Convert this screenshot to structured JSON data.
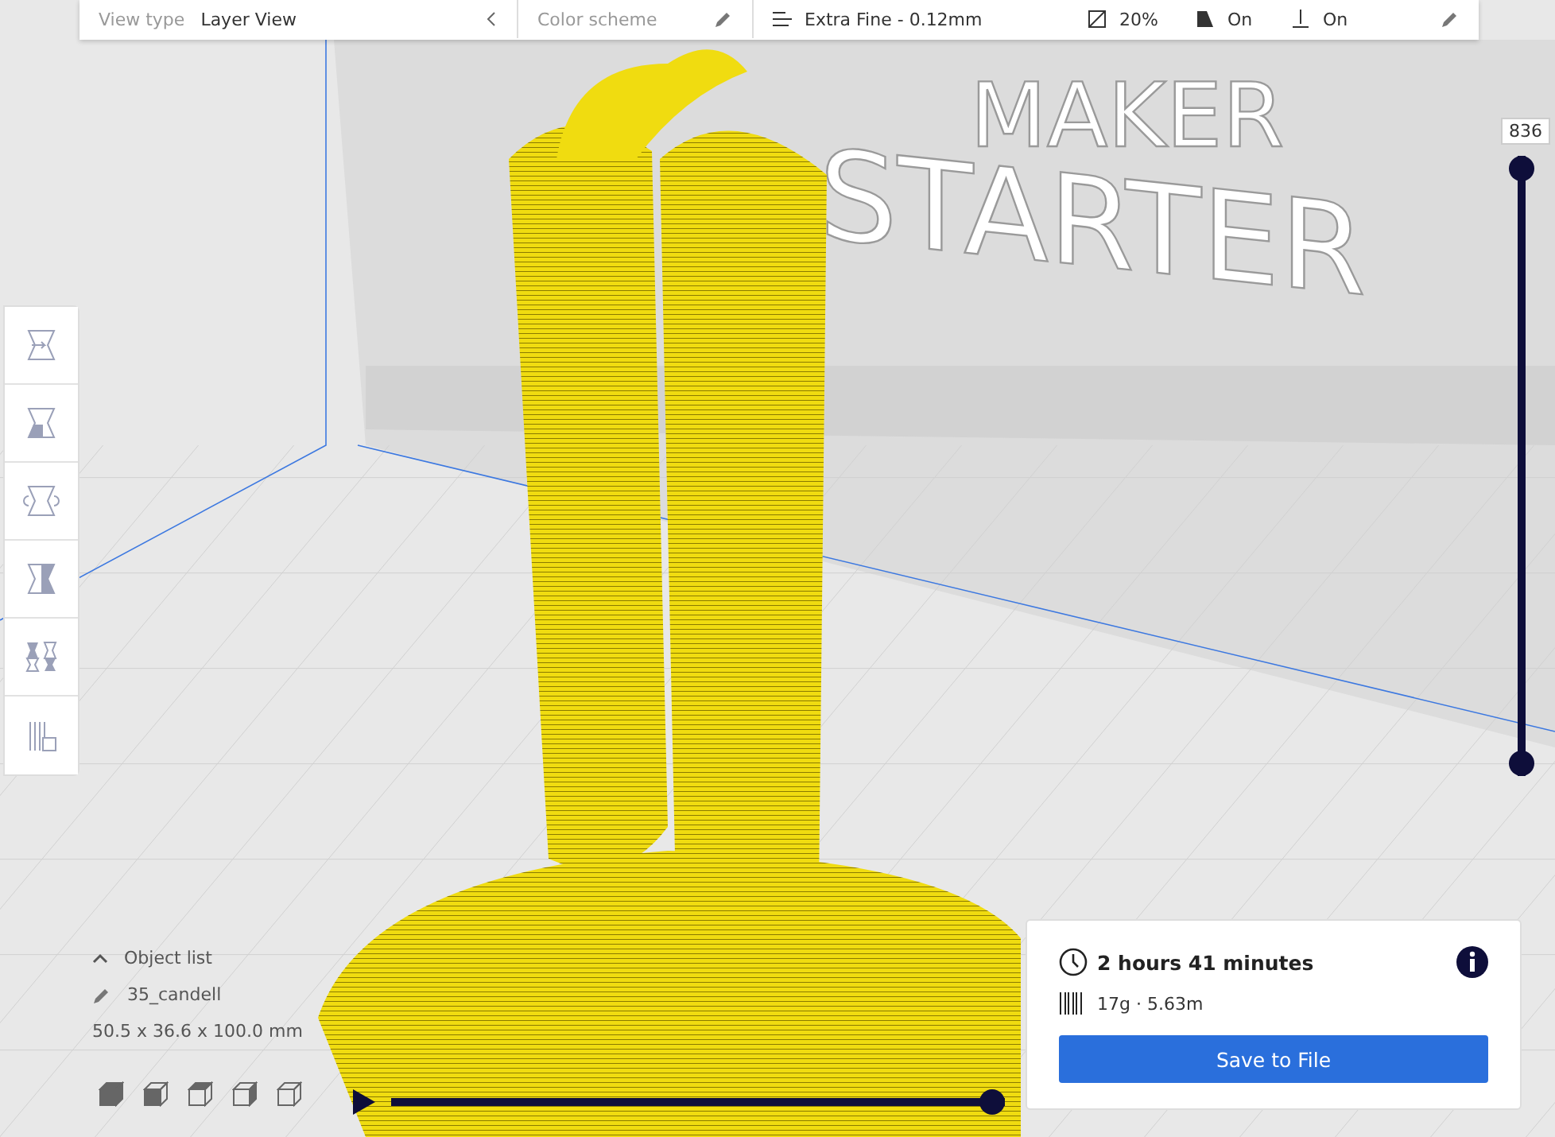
{
  "view_bar": {
    "view_type_label": "View type",
    "view_type_value": "Layer View",
    "color_scheme_label": "Color scheme",
    "profile": "Extra Fine - 0.12mm",
    "infill": "20%",
    "support": "On",
    "adhesion": "On"
  },
  "scene_text": [
    "MAKER",
    "STARTER"
  ],
  "tools": [
    {
      "kind": "move"
    },
    {
      "kind": "scale"
    },
    {
      "kind": "rotate"
    },
    {
      "kind": "mirror"
    },
    {
      "kind": "per-model"
    },
    {
      "kind": "support-blocker"
    }
  ],
  "layer_slider": {
    "label": "836",
    "top_handle": {
      "level": 1
    },
    "bottom_handle": {
      "level": 0
    }
  },
  "object_info": {
    "list_label": "Object list",
    "name": "35_candell",
    "dimensions": "50.5 x 36.6 x 100.0 mm"
  },
  "view_buttons": [
    {
      "kind": "iso"
    },
    {
      "kind": "front"
    },
    {
      "kind": "top"
    },
    {
      "kind": "left"
    },
    {
      "kind": "right"
    }
  ],
  "playback": {
    "level": 1
  },
  "print_summary": {
    "time": "2 hours 41 minutes",
    "material": "17g · 5.63m",
    "button": "Save to File"
  }
}
